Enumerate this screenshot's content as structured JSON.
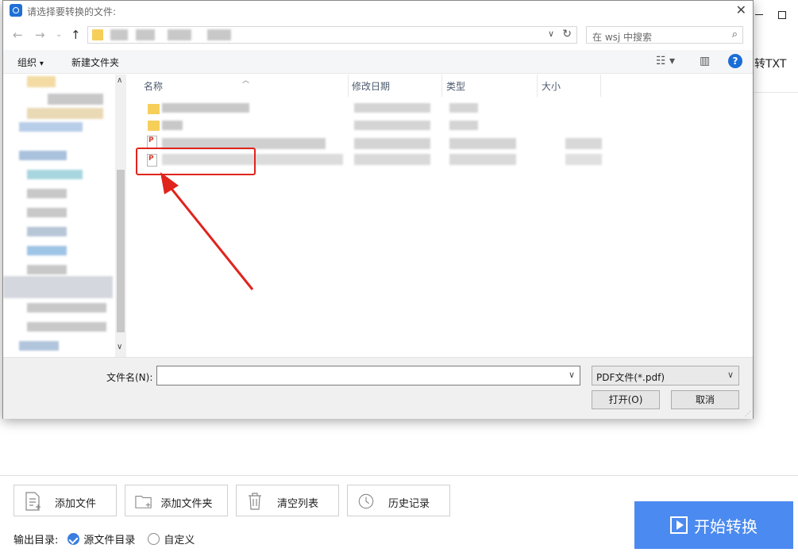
{
  "dialog": {
    "title": "请选择要转换的文件:",
    "search_placeholder": "在 wsj 中搜索",
    "toolbar": {
      "organize": "组织",
      "organize_caret": "▾",
      "new_folder": "新建文件夹"
    },
    "columns": {
      "name": "名称",
      "date": "修改日期",
      "type": "类型",
      "size": "大小"
    },
    "filename_label": "文件名(N):",
    "filename_value": "",
    "filetype_value": "PDF文件(*.pdf)",
    "open_button": "打开(O)",
    "cancel_button": "取消",
    "help_glyph": "?"
  },
  "app": {
    "tab_partial": "转TXT",
    "buttons": {
      "add_file": "添加文件",
      "add_folder": "添加文件夹",
      "clear_list": "清空列表",
      "history": "历史记录"
    },
    "output_label": "输出目录:",
    "output_options": [
      "源文件目录",
      "自定义"
    ],
    "start_button": "开始转换"
  },
  "colors": {
    "accent": "#4b8af0",
    "highlight": "#e0241c",
    "folder": "#f6cf5b"
  }
}
